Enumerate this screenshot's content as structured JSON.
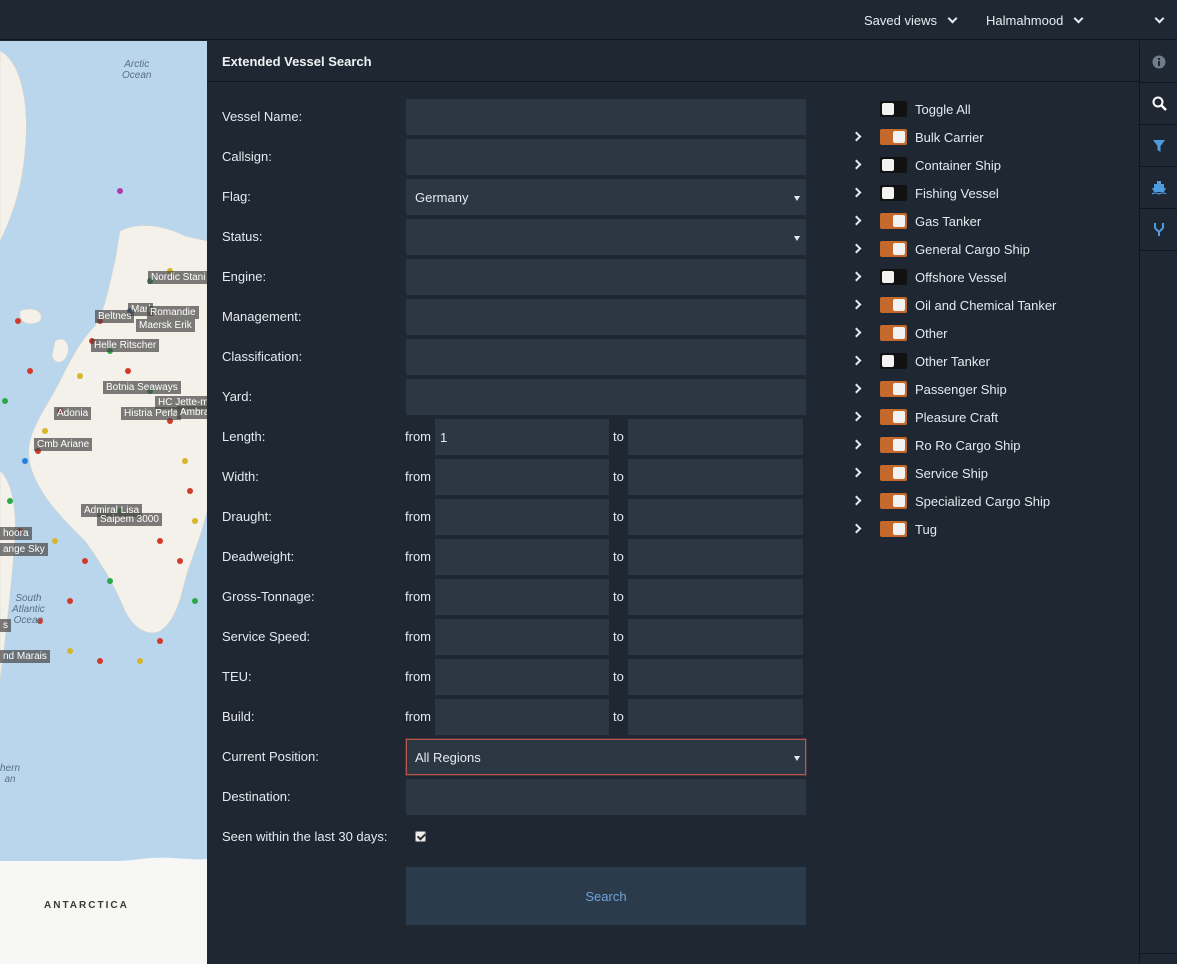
{
  "topbar": {
    "saved_views": "Saved views",
    "user": "Halmahmood"
  },
  "map": {
    "vessel_labels": [
      "Nordic Stani",
      "Marl",
      "Romandie",
      "Beltnes",
      "Maersk Erik",
      "Helle Ritscher",
      "Botnia Seaways",
      "HC Jette-m",
      "Adonia",
      "Histria Perla",
      "Ambra",
      "Cmb Ariane",
      "Admiral Lisa",
      "Saipem 3000",
      "hoora",
      "ange Sky",
      "s",
      "nd Marais"
    ],
    "ocean_labels": [
      "Arctic\nOcean",
      "South\nAtlantic\nOcean",
      "hern\nan"
    ],
    "continent_label": "ANTARCTICA"
  },
  "panel": {
    "title": "Extended Vessel Search",
    "fields": {
      "vessel_name": {
        "label": "Vessel Name:",
        "value": ""
      },
      "callsign": {
        "label": "Callsign:",
        "value": ""
      },
      "flag": {
        "label": "Flag:",
        "value": "Germany"
      },
      "status": {
        "label": "Status:",
        "value": ""
      },
      "engine": {
        "label": "Engine:",
        "value": ""
      },
      "management": {
        "label": "Management:",
        "value": ""
      },
      "classification": {
        "label": "Classification:",
        "value": ""
      },
      "yard": {
        "label": "Yard:",
        "value": ""
      },
      "current_position": {
        "label": "Current Position:",
        "value": "All Regions"
      },
      "destination": {
        "label": "Destination:",
        "value": ""
      },
      "seen_recent": {
        "label": "Seen within the last 30 days:",
        "checked": true
      }
    },
    "ranges": [
      {
        "label": "Length:",
        "from": "1",
        "to": ""
      },
      {
        "label": "Width:",
        "from": "",
        "to": ""
      },
      {
        "label": "Draught:",
        "from": "",
        "to": ""
      },
      {
        "label": "Deadweight:",
        "from": "",
        "to": ""
      },
      {
        "label": "Gross-Tonnage:",
        "from": "",
        "to": ""
      },
      {
        "label": "Service Speed:",
        "from": "",
        "to": ""
      },
      {
        "label": "TEU:",
        "from": "",
        "to": ""
      },
      {
        "label": "Build:",
        "from": "",
        "to": ""
      }
    ],
    "from_text": "from",
    "to_text": "to",
    "search_label": "Search"
  },
  "vessel_types": [
    {
      "label": "Toggle All",
      "on": false,
      "expandable": false
    },
    {
      "label": "Bulk Carrier",
      "on": true,
      "expandable": true
    },
    {
      "label": "Container Ship",
      "on": false,
      "expandable": true
    },
    {
      "label": "Fishing Vessel",
      "on": false,
      "expandable": true
    },
    {
      "label": "Gas Tanker",
      "on": true,
      "expandable": true
    },
    {
      "label": "General Cargo Ship",
      "on": true,
      "expandable": true
    },
    {
      "label": "Offshore Vessel",
      "on": false,
      "expandable": true
    },
    {
      "label": "Oil and Chemical Tanker",
      "on": true,
      "expandable": true
    },
    {
      "label": "Other",
      "on": true,
      "expandable": true
    },
    {
      "label": "Other Tanker",
      "on": false,
      "expandable": true
    },
    {
      "label": "Passenger Ship",
      "on": true,
      "expandable": true
    },
    {
      "label": "Pleasure Craft",
      "on": true,
      "expandable": true
    },
    {
      "label": "Ro Ro Cargo Ship",
      "on": true,
      "expandable": true
    },
    {
      "label": "Service Ship",
      "on": true,
      "expandable": true
    },
    {
      "label": "Specialized Cargo Ship",
      "on": true,
      "expandable": true
    },
    {
      "label": "Tug",
      "on": true,
      "expandable": true
    }
  ],
  "rail": {
    "icons": [
      "info-icon",
      "search-icon",
      "filter-icon",
      "ship-icon",
      "route-icon"
    ]
  },
  "colors": {
    "background": "#1e2732",
    "input": "#2c3744",
    "toggle_on": "#c4682c",
    "search_text": "#6ea3d6",
    "focus_border": "#b9574b"
  }
}
